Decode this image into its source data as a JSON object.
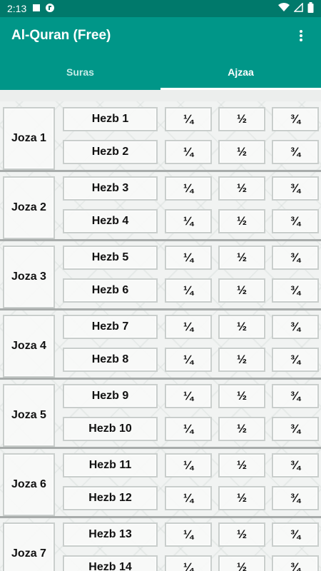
{
  "status_bar": {
    "time": "2:13"
  },
  "app": {
    "title": "Al-Quran (Free)"
  },
  "tabs": [
    {
      "label": "Suras"
    },
    {
      "label": "Ajzaa"
    }
  ],
  "quarters": {
    "q1": "¼",
    "q2": "½",
    "q3": "¾"
  },
  "ajzaa": [
    {
      "label": "Joza 1",
      "hezb": [
        "Hezb 1",
        "Hezb 2"
      ]
    },
    {
      "label": "Joza 2",
      "hezb": [
        "Hezb 3",
        "Hezb 4"
      ]
    },
    {
      "label": "Joza 3",
      "hezb": [
        "Hezb 5",
        "Hezb 6"
      ]
    },
    {
      "label": "Joza 4",
      "hezb": [
        "Hezb 7",
        "Hezb 8"
      ]
    },
    {
      "label": "Joza 5",
      "hezb": [
        "Hezb 9",
        "Hezb 10"
      ]
    },
    {
      "label": "Joza 6",
      "hezb": [
        "Hezb 11",
        "Hezb 12"
      ]
    },
    {
      "label": "Joza 7",
      "hezb": [
        "Hezb 13",
        "Hezb 14"
      ]
    }
  ]
}
